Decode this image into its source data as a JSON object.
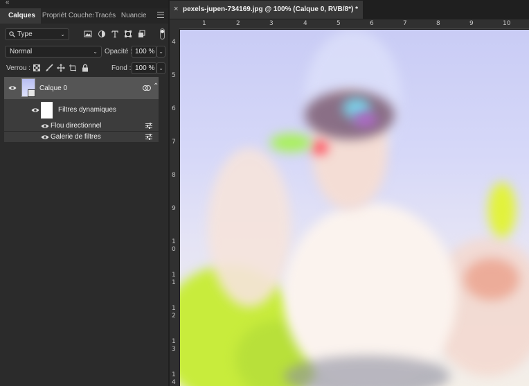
{
  "panel": {
    "collapse_glyph": "«",
    "tabs": [
      {
        "label": "Calques",
        "active": true
      },
      {
        "label": "Propriét",
        "active": false
      },
      {
        "label": "Couches",
        "active": false
      },
      {
        "label": "Tracés",
        "active": false
      },
      {
        "label": "Nuancie",
        "active": false
      }
    ],
    "filter": {
      "kind_label": "Type",
      "icons": [
        "image-filter-icon",
        "adjustment-filter-icon",
        "text-filter-icon",
        "shape-filter-icon",
        "smart-object-filter-icon"
      ]
    },
    "blend_mode": "Normal",
    "opacity_label": "Opacité :",
    "opacity_value": "100 %",
    "lock_label": "Verrou :",
    "lock_icons": [
      "lock-transparent-icon",
      "lock-image-icon",
      "lock-position-icon",
      "lock-artboard-icon",
      "lock-all-icon"
    ],
    "fill_label": "Fond :",
    "fill_value": "100 %",
    "layers": {
      "layer0_name": "Calque 0",
      "smart_filters_label": "Filtres dynamiques",
      "filters": [
        "Flou directionnel",
        "Galerie de filtres"
      ]
    }
  },
  "document": {
    "tab_title": "pexels-jupen-734169.jpg @ 100% (Calque 0, RVB/8*) *",
    "close_glyph": "×",
    "h_ruler": [
      "1",
      "2",
      "3",
      "4",
      "5",
      "6",
      "7",
      "8",
      "9",
      "10"
    ],
    "v_ruler": [
      "4",
      "5",
      "6",
      "7",
      "8",
      "9",
      "1 0",
      "1 1",
      "1 2",
      "1 3",
      "1 4"
    ]
  },
  "colors": {
    "panel_bg": "#2b2b2b",
    "selected_layer": "#555555",
    "canvas_sky": "#c9ccf5"
  }
}
